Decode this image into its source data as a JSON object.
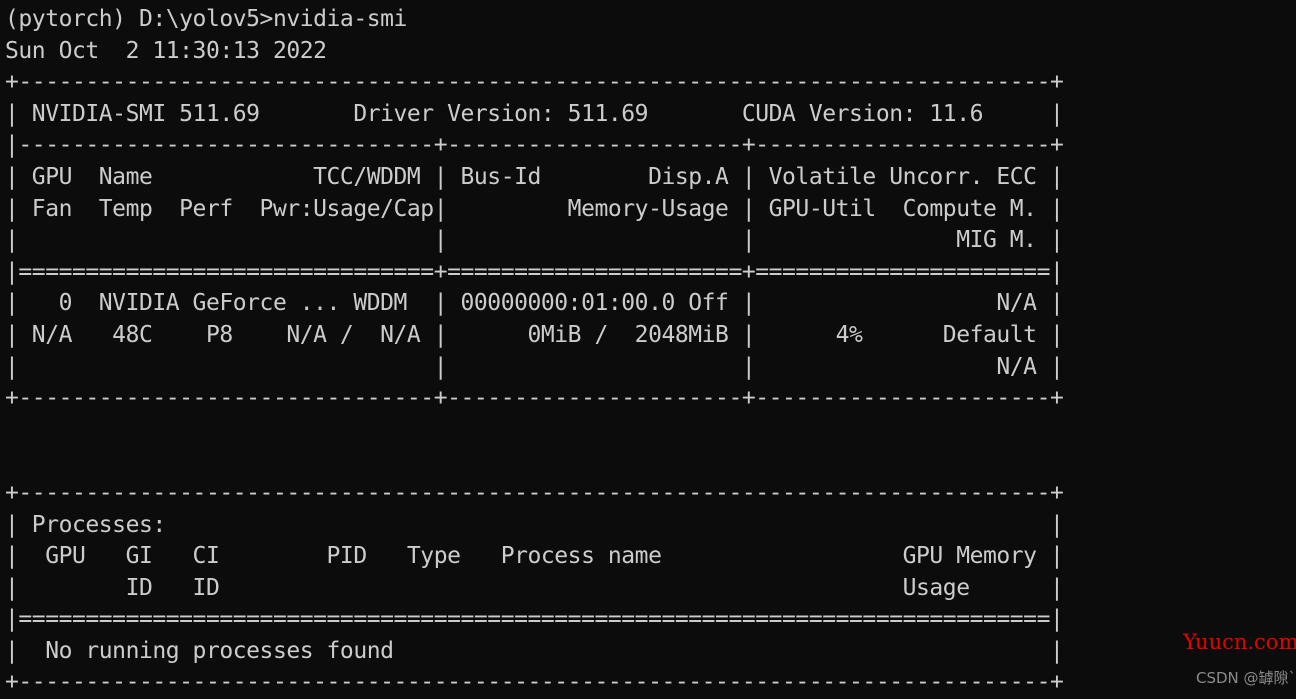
{
  "terminal": {
    "background_color": "#0c0c0c",
    "text_color": "#cccccc",
    "prompt_line": "(pytorch) D:\\yolov5>nvidia-smi",
    "env_name": "pytorch",
    "cwd": "D:\\yolov5",
    "command": "nvidia-smi",
    "timestamp": "Sun Oct  2 11:30:13 2022"
  },
  "smi": {
    "header": {
      "smi_version_label": "NVIDIA-SMI",
      "smi_version": "511.69",
      "driver_version_label": "Driver Version:",
      "driver_version": "511.69",
      "cuda_version_label": "CUDA Version:",
      "cuda_version": "11.6"
    },
    "column_headers": {
      "row1": [
        "GPU",
        "Name",
        "TCC/WDDM",
        "Bus-Id",
        "Disp.A",
        "Volatile Uncorr. ECC"
      ],
      "row2": [
        "Fan",
        "Temp",
        "Perf",
        "Pwr:Usage/Cap",
        "Memory-Usage",
        "GPU-Util",
        "Compute M."
      ],
      "row3": [
        "MIG M."
      ]
    },
    "gpus": [
      {
        "index": "0",
        "name": "NVIDIA GeForce ...",
        "tcc_wddm": "WDDM",
        "bus_id": "00000000:01:00.0",
        "disp_a": "Off",
        "ecc": "N/A",
        "fan": "N/A",
        "temp": "48C",
        "perf": "P8",
        "pwr_usage": "N/A",
        "pwr_cap": "N/A",
        "memory_used": "0MiB",
        "memory_total": "2048MiB",
        "gpu_util": "4%",
        "compute_mode": "Default",
        "mig_mode": "N/A"
      }
    ]
  },
  "processes": {
    "section_title": "Processes:",
    "column_headers": {
      "row1": [
        "GPU",
        "GI",
        "CI",
        "PID",
        "Type",
        "Process name",
        "GPU Memory"
      ],
      "row2": [
        "ID",
        "ID",
        "Usage"
      ]
    },
    "empty_message": "No running processes found",
    "rows": []
  },
  "lines": [
    "(pytorch) D:\\yolov5>nvidia-smi",
    "Sun Oct  2 11:30:13 2022",
    "+-----------------------------------------------------------------------------+",
    "| NVIDIA-SMI 511.69       Driver Version: 511.69       CUDA Version: 11.6     |",
    "|-------------------------------+----------------------+----------------------+",
    "| GPU  Name            TCC/WDDM | Bus-Id        Disp.A | Volatile Uncorr. ECC |",
    "| Fan  Temp  Perf  Pwr:Usage/Cap|         Memory-Usage | GPU-Util  Compute M. |",
    "|                               |                      |               MIG M. |",
    "|===============================+======================+======================|",
    "|   0  NVIDIA GeForce ... WDDM  | 00000000:01:00.0 Off |                  N/A |",
    "| N/A   48C    P8    N/A /  N/A |      0MiB /  2048MiB |      4%      Default |",
    "|                               |                      |                  N/A |",
    "+-------------------------------+----------------------+----------------------+",
    "",
    "",
    "+-----------------------------------------------------------------------------+",
    "| Processes:                                                                  |",
    "|  GPU   GI   CI        PID   Type   Process name                  GPU Memory |",
    "|        ID   ID                                                   Usage      |",
    "|=============================================================================|",
    "|  No running processes found                                                 |",
    "+-----------------------------------------------------------------------------+"
  ],
  "watermarks": {
    "yuucn": {
      "text": "Yuucn.com",
      "color": "#e60000"
    },
    "csdn": {
      "text": "CSDN @罅隙`",
      "color": "#8a8a8a"
    }
  }
}
